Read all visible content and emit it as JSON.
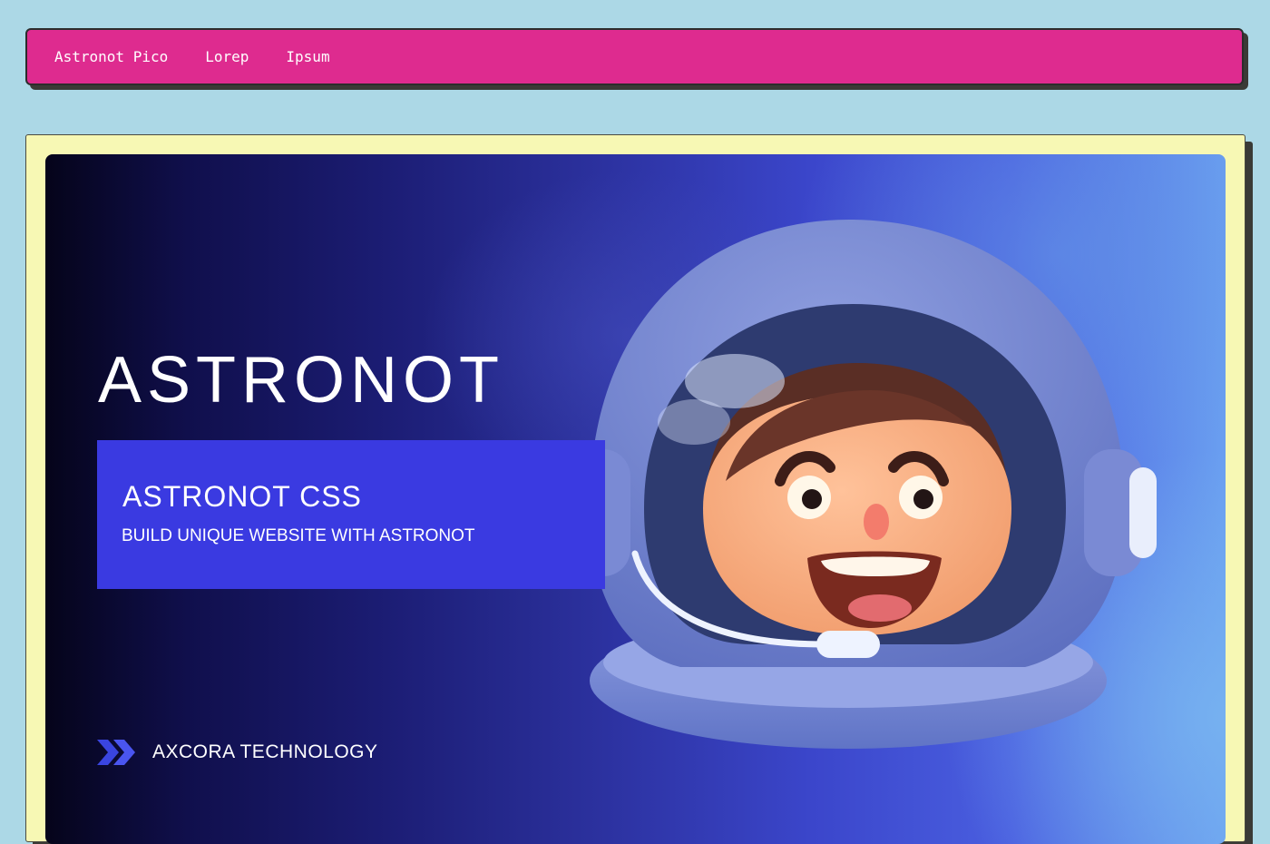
{
  "navbar": {
    "links": [
      {
        "label": "Astronot Pico"
      },
      {
        "label": "Lorep"
      },
      {
        "label": "Ipsum"
      }
    ]
  },
  "hero": {
    "title": "ASTRONOT",
    "subtitle": "ASTRONOT CSS",
    "tagline": "BUILD UNIQUE WEBSITE WITH ASTRONOT",
    "brand": "AXCORA TECHNOLOGY"
  },
  "colors": {
    "page_background": "#acd8e6",
    "navbar": "#de2b8f",
    "card": "#f7f8b4",
    "hero_box": "#3a3ae1"
  },
  "icons": {
    "brand_logo": "double-chevron-right-icon"
  }
}
